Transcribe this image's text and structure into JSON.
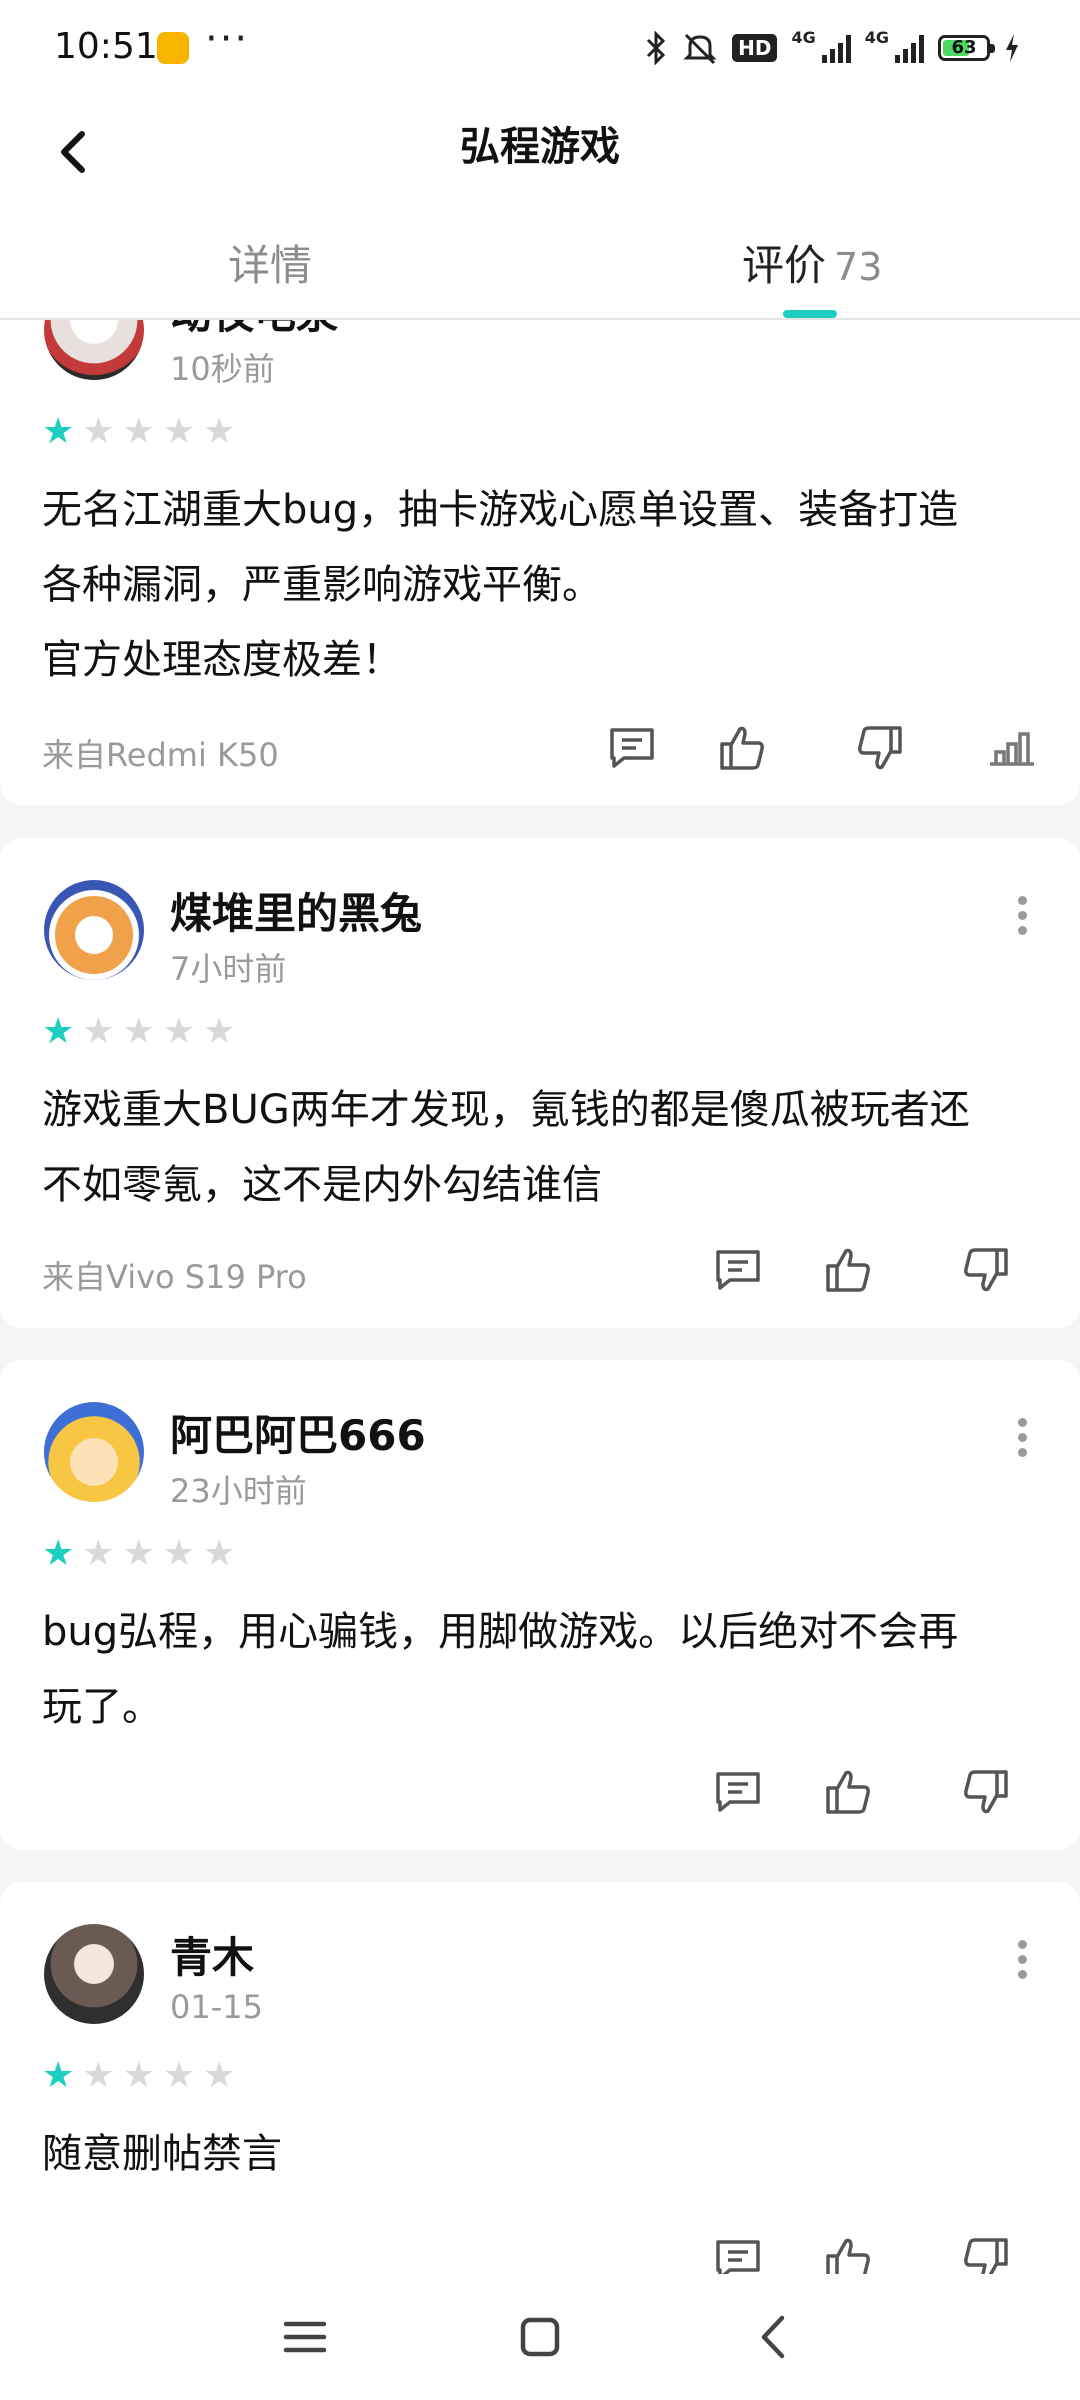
{
  "status_bar": {
    "time": "10:51",
    "more": "···",
    "network_1": "4G",
    "network_2": "4G",
    "battery_level": "63",
    "icons": [
      "app-notification-icon",
      "bluetooth-icon",
      "mute-icon",
      "hd-icon",
      "signal-icon",
      "battery-icon",
      "charging-icon"
    ]
  },
  "app_bar": {
    "title": "弘程游戏",
    "back_icon": "chevron-left-icon"
  },
  "tabs": [
    {
      "label": "详情",
      "count": ""
    },
    {
      "label": "评价",
      "count": "73",
      "active": true
    }
  ],
  "accent_color": "#1ccfc0",
  "reviews": [
    {
      "username": "动夜电泉",
      "time": "10秒前",
      "rating": 1,
      "content": "无名江湖重大bug，抽卡游戏心愿单设置、装备打造\n各种漏洞，严重影响游戏平衡。\n官方处理态度极差！",
      "device": "来自Redmi K50"
    },
    {
      "username": "煤堆里的黑兔",
      "time": "7小时前",
      "rating": 1,
      "content": "游戏重大BUG两年才发现，氪钱的都是傻瓜被玩者还\n不如零氪，这不是内外勾结谁信",
      "device": "来自Vivo S19 Pro"
    },
    {
      "username": "阿巴阿巴666",
      "time": "23小时前",
      "rating": 1,
      "content": "bug弘程，用心骗钱，用脚做游戏。以后绝对不会再\n玩了。",
      "device": ""
    },
    {
      "username": "青木",
      "time": "01-15",
      "rating": 1,
      "content": "随意删帖禁言",
      "device": ""
    }
  ],
  "nav_bar": {
    "icons": [
      "menu-icon",
      "home-icon",
      "back-icon"
    ]
  }
}
